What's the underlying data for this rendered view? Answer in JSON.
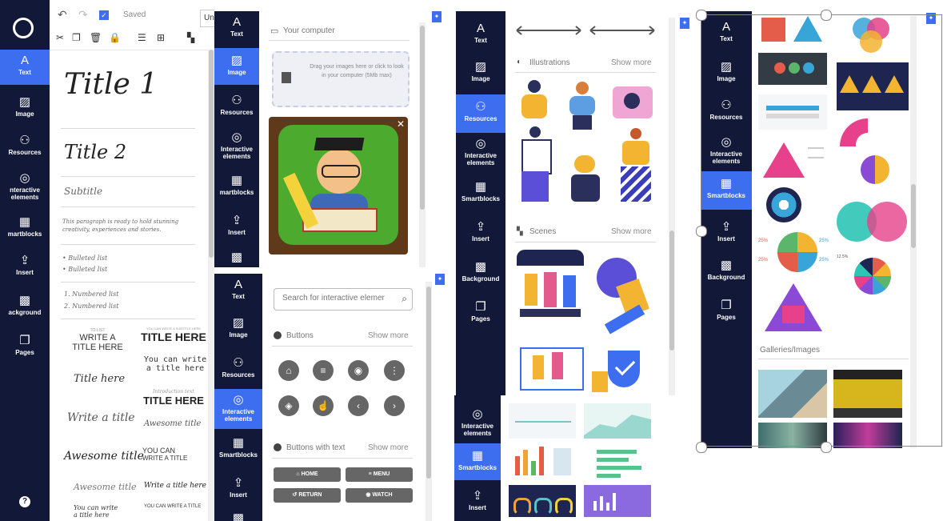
{
  "colors": {
    "sidebar": "#121838",
    "accent": "#3d6ef0",
    "button_gray": "#666666"
  },
  "editor": {
    "saved": "Saved",
    "tab_partial": "Un",
    "titles": {
      "title1": "Title 1",
      "title2": "Title 2",
      "subtitle": "Subtitle",
      "paragraph": "This paragraph is ready to hold stunning creativity, experiences and stories.",
      "bullet1": "Bulleted list",
      "bullet2": "Bulleted list",
      "num1": "1. Numbered list",
      "num2": "2. Numbered list"
    },
    "combos": {
      "c1_small": "TO LIST",
      "c1a": "WRITE A",
      "c1b": "TITLE HERE",
      "c2_small": "YOU CAN WRITE A SUBTITLE HERE",
      "c2": "TITLE HERE",
      "c3a": "You can write",
      "c3b": "a title here",
      "c4": "Title here",
      "c5_small": "Introduction text",
      "c5": "TITLE HERE",
      "c6": "Write a title",
      "c7": "Awesome title",
      "c8": "Awesome title",
      "c9a": "YOU CAN",
      "c9b": "WRITE A TITLE",
      "c10": "Awesome title",
      "c11": "Write a title here",
      "c12": "YOU CAN WRITE A TITLE",
      "c13a": "You can write",
      "c13b": "a title here"
    }
  },
  "nav": {
    "text": "Text",
    "image": "Image",
    "resources": "Resources",
    "interactive": "Interactive elements",
    "smartblocks": "Smartblocks",
    "smartblocks_cut": "martblocks",
    "insert": "Insert",
    "background": "Background",
    "background_cut": "ackground",
    "pages": "Pages",
    "interactive_cut": "nteractive elements",
    "smartblocks_cut2": "martblocks",
    "help": "?"
  },
  "image_panel": {
    "your_computer": "Your computer",
    "drop_text": "Drag your images here or click to look in your computer (5Mb max)"
  },
  "interactive_panel": {
    "search_placeholder": "Search for interactive elemer",
    "buttons_header": "Buttons",
    "show_more": "Show more",
    "buttons_text_header": "Buttons with text",
    "show_more2": "Show more",
    "btn_home": "HOME",
    "btn_menu": "MENU",
    "btn_return": "RETURN",
    "btn_watch": "WATCH"
  },
  "resources_panel": {
    "illustrations": "Illustrations",
    "show_more": "Show more",
    "scenes": "Scenes",
    "show_more2": "Show more"
  },
  "smartblocks_panel": {
    "galleries": "Galleries/Images",
    "pct_a": "25%",
    "pct_b": "25%",
    "pct_c": "25%",
    "pct_d": "25%",
    "pct_e": "12.5%"
  }
}
